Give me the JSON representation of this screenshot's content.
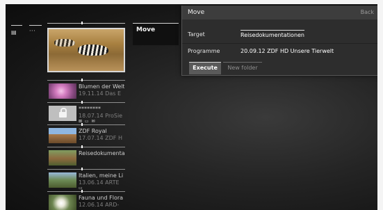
{
  "left_tabs": {
    "tab1_icon": "▤",
    "tab2_label": "···"
  },
  "side_menu": {
    "move_label": "Move"
  },
  "dialog": {
    "title": "Move",
    "back_label": "Back",
    "target_label": "Target",
    "target_value": "Reisedokumentationen",
    "programme_label": "Programme",
    "programme_value": "20.09.12 ZDF HD Unsere Tierwelt",
    "execute_label": "Execute",
    "new_folder_label": "New folder"
  },
  "recordings": {
    "items": [
      {
        "title": "Blumen der Welt",
        "sub": "19.11.14 Das E"
      },
      {
        "title": "********",
        "sub": "18.07.14 ProSie",
        "badges": "⊠ ▭ ✉"
      },
      {
        "title": "ZDF Royal",
        "sub": "17.07.14 ZDF H"
      },
      {
        "title": "Reisedokumentat",
        "sub": ""
      },
      {
        "title": "Italien, meine Li",
        "sub": "13.06.14 ARTE",
        "badges": "▭"
      },
      {
        "title": "Fauna und Flora",
        "sub": "12.06.14 ARD-"
      }
    ]
  }
}
